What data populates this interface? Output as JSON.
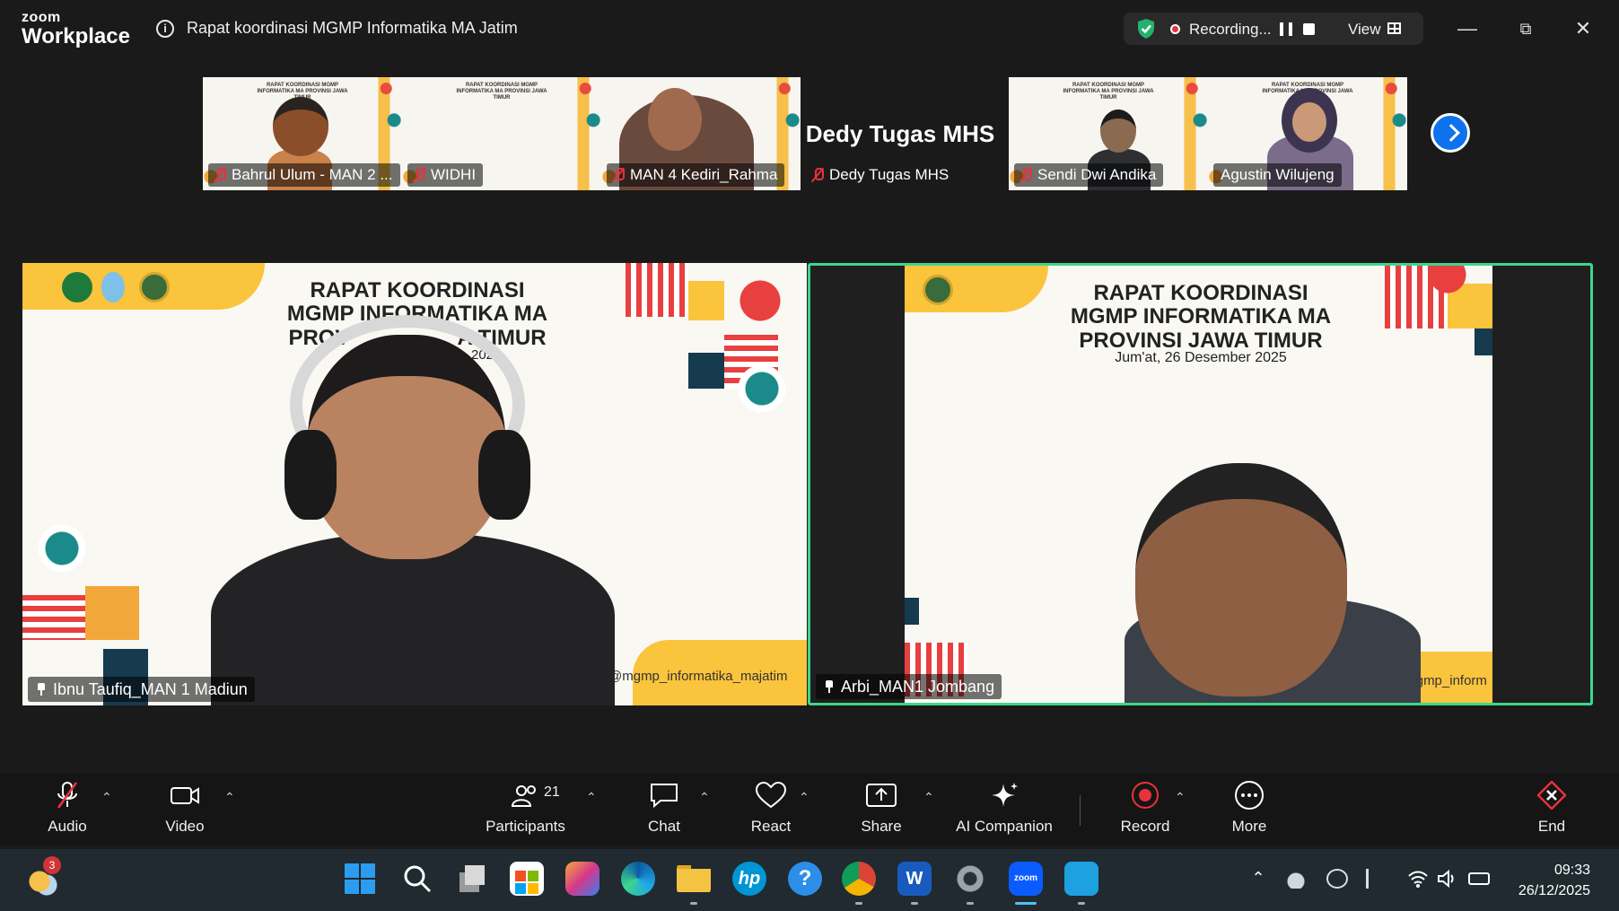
{
  "brand": {
    "line1": "zoom",
    "line2": "Workplace"
  },
  "meeting_title": "Rapat koordinasi MGMP Informatika MA Jatim",
  "recording": {
    "label": "Recording...",
    "view_label": "View"
  },
  "filmstrip": [
    {
      "name": "Bahrul Ulum - MAN 2 ...",
      "muted": true
    },
    {
      "name": "WIDHI",
      "muted": true
    },
    {
      "name": "MAN 4 Kediri_Rahma",
      "muted": true
    },
    {
      "name": "Dedy Tugas MHS",
      "muted": true,
      "video_off_name": "Dedy Tugas MHS"
    },
    {
      "name": "Sendi Dwi Andika",
      "muted": true
    },
    {
      "name": "Agustin Wilujeng",
      "muted": false
    }
  ],
  "slide": {
    "title_line1": "RAPAT KOORDINASI",
    "title_line2": "MGMP INFORMATIKA MA",
    "title_line3": "PROVINSI JAWA TIMUR",
    "date": "Jum'at, 26 Desember 2025",
    "left_visible_line3": "PROV",
    "left_visible_line3b": "A TIMUR",
    "left_visible_date": "2025",
    "handle_left": "@mgmp_informatika_majatim",
    "handle_right": "@mgmp_inform",
    "mini_title": "RAPAT KOORDINASI MGMP INFORMATIKA MA PROVINSI JAWA TIMUR"
  },
  "main_tiles": [
    {
      "name": "Ibnu Taufiq_MAN 1 Madiun"
    },
    {
      "name": "Arbi_MAN1 Jombang"
    }
  ],
  "toolbar": {
    "audio": "Audio",
    "video": "Video",
    "participants": "Participants",
    "participants_count": "21",
    "chat": "Chat",
    "react": "React",
    "share": "Share",
    "ai": "AI Companion",
    "record": "Record",
    "more": "More",
    "end": "End"
  },
  "taskbar": {
    "weather_badge": "3",
    "time": "09:33",
    "date": "26/12/2025"
  },
  "colors": {
    "active_speaker_border": "#3dd68c",
    "zoom_blue": "#0e72ed",
    "record_red": "#e8323c",
    "end_red": "#e8323c",
    "slide_yellow": "#fbc43d"
  }
}
